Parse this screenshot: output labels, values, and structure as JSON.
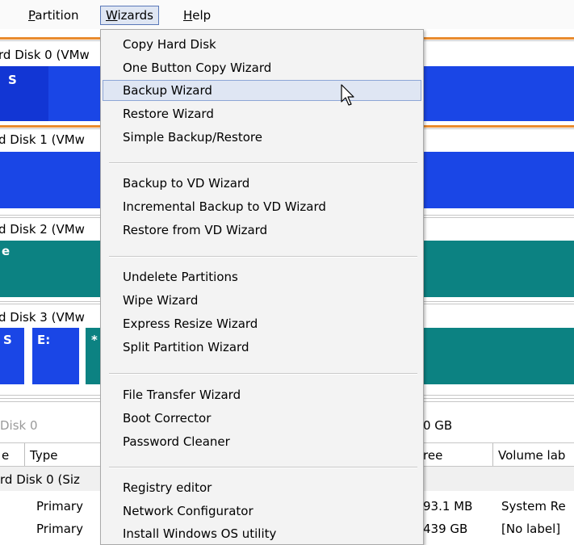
{
  "menubar": {
    "items": [
      {
        "label": "Partition"
      },
      {
        "label": "Wizards"
      },
      {
        "label": "Help"
      }
    ]
  },
  "disk_map": {
    "disks": [
      {
        "label": "rd Disk 0 (VMw",
        "segment_text": "S"
      },
      {
        "label": "d Disk 1 (VMw"
      },
      {
        "label": "d Disk 2 (VMw",
        "segment_text": "e"
      },
      {
        "label": "d Disk 3 (VMw",
        "segments": [
          "S",
          "E:",
          "*"
        ]
      }
    ]
  },
  "details": {
    "header_left": "Disk 0",
    "header_right": "0 GB",
    "columns": [
      "e",
      "Type",
      "ree",
      "Volume lab"
    ],
    "group_label": "rd Disk 0 (Siz",
    "rows": [
      {
        "type": "Primary",
        "free": "93.1 MB",
        "volume_label": "System Re"
      },
      {
        "type": "Primary",
        "free": "439 GB",
        "volume_label": "[No label]"
      }
    ]
  },
  "wizards_menu": {
    "groups": [
      [
        "Copy Hard Disk",
        "One Button Copy Wizard",
        "Backup Wizard",
        "Restore Wizard",
        "Simple Backup/Restore"
      ],
      [
        "Backup to VD Wizard",
        "Incremental Backup to VD Wizard",
        "Restore from VD Wizard"
      ],
      [
        "Undelete Partitions",
        "Wipe Wizard",
        "Express Resize Wizard",
        "Split Partition Wizard"
      ],
      [
        "File Transfer Wizard",
        "Boot Corrector",
        "Password Cleaner"
      ],
      [
        "Registry editor",
        "Network Configurator",
        "Install Windows OS utility"
      ]
    ],
    "highlighted_item": "Backup Wizard"
  },
  "colors": {
    "partition_blue": "#1a46e6",
    "partition_teal": "#0c8282",
    "disk_separator": "#e98b2e",
    "menu_highlight": "#dfe6f3"
  }
}
